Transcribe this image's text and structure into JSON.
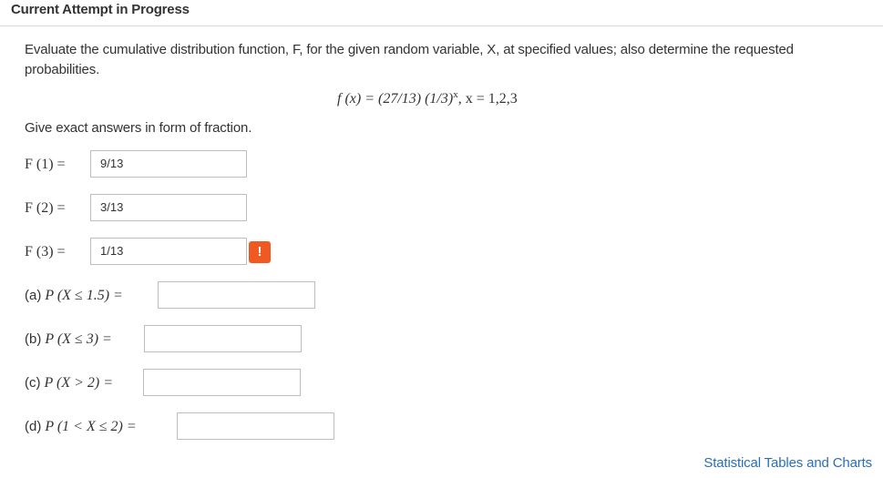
{
  "header": {
    "title": "Current Attempt in Progress"
  },
  "question": {
    "instructions": "Evaluate the cumulative distribution function, F, for the given random variable, X, at specified values; also determine the requested probabilities.",
    "formula": {
      "lhs": "f (x) = (27/13) (1/3)",
      "exponent": "x",
      "rhs": ", x = 1,2,3"
    },
    "note": "Give exact answers in form of fraction."
  },
  "cdf_inputs": [
    {
      "label": "F (1) =",
      "value": "9/13"
    },
    {
      "label": "F (2) =",
      "value": "3/13"
    },
    {
      "label": "F (3) =",
      "value": "1/13"
    }
  ],
  "warning_icon": {
    "symbol": "!",
    "color": "#f05a22"
  },
  "probability_inputs": [
    {
      "tag": "(a)",
      "expr": "P (X ≤ 1.5) =",
      "value": ""
    },
    {
      "tag": "(b)",
      "expr": "P (X ≤ 3) =",
      "value": ""
    },
    {
      "tag": "(c)",
      "expr": "P (X > 2) =",
      "value": ""
    },
    {
      "tag": "(d)",
      "expr": "P (1 < X ≤ 2) =",
      "value": ""
    }
  ],
  "footer": {
    "link_text": "Statistical Tables and Charts",
    "link_color": "#2a6ebb"
  }
}
